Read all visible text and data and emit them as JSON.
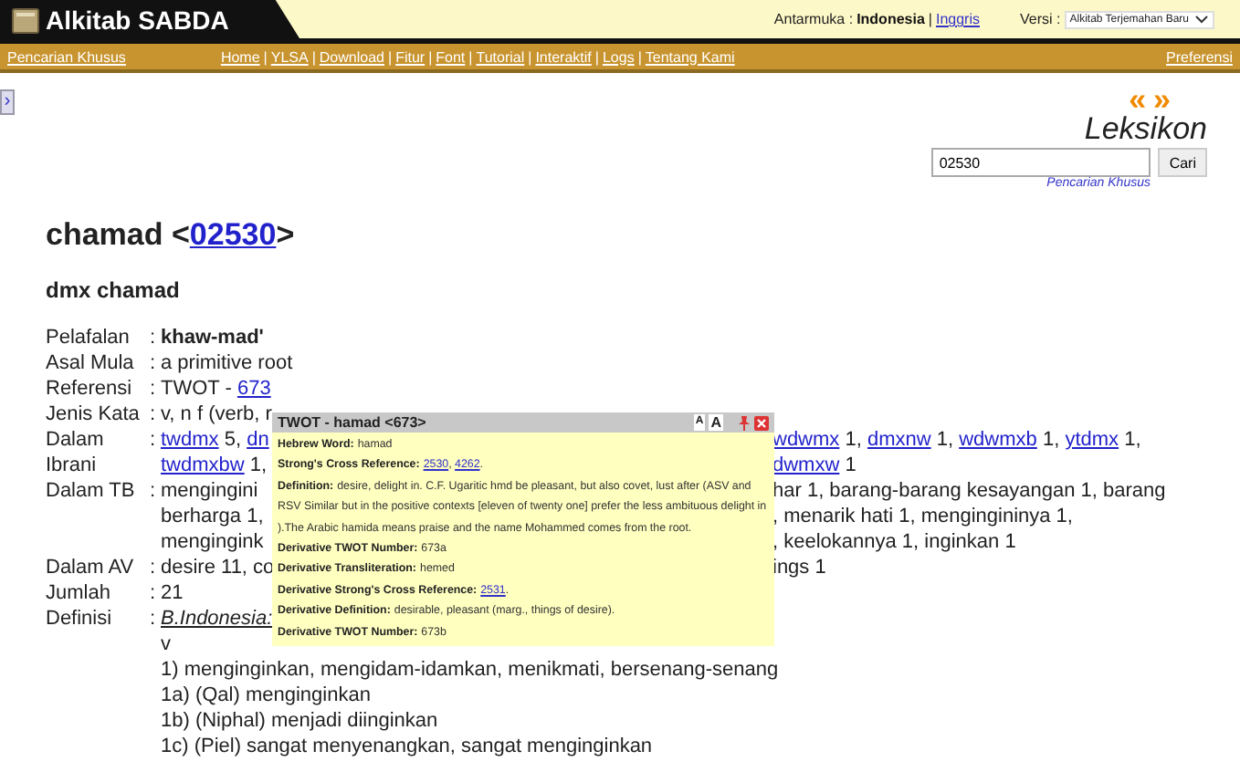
{
  "header": {
    "logo": "Alkitab SABDA",
    "interface_label": "Antarmuka :",
    "languages": [
      {
        "label": "Indonesia",
        "selected": true
      },
      {
        "label": "Inggris",
        "selected": false
      }
    ],
    "language_separator": "|",
    "version_label": "Versi :",
    "version_value": "Alkitab Terjemahan Baru"
  },
  "nav": {
    "left": "Pencarian Khusus",
    "items": [
      {
        "kind": "link",
        "text": "Home"
      },
      {
        "kind": "sep",
        "text": "|"
      },
      {
        "kind": "link",
        "text": "YLSA"
      },
      {
        "kind": "sep",
        "text": "|"
      },
      {
        "kind": "link",
        "text": "Download"
      },
      {
        "kind": "sep",
        "text": "|"
      },
      {
        "kind": "link",
        "text": "Fitur"
      },
      {
        "kind": "sep",
        "text": "|"
      },
      {
        "kind": "link",
        "text": "Font"
      },
      {
        "kind": "sep",
        "text": "|"
      },
      {
        "kind": "link",
        "text": "Tutorial"
      },
      {
        "kind": "sep",
        "text": "|"
      },
      {
        "kind": "link",
        "text": "Interaktif"
      },
      {
        "kind": "sep",
        "text": "|"
      },
      {
        "kind": "link",
        "text": "Logs"
      },
      {
        "kind": "sep",
        "text": "|"
      },
      {
        "kind": "link",
        "text": "Tentang Kami"
      }
    ],
    "right": "Preferensi"
  },
  "sidebar_toggle": "›",
  "lexicon": {
    "prev": "«",
    "next": "»",
    "title": "Leksikon",
    "search_value": "02530",
    "search_button": "Cari",
    "advanced_link": "Pencarian Khusus"
  },
  "entry": {
    "word": "chamad",
    "open": "<",
    "number": "02530",
    "close": ">",
    "subtitle": "dmx chamad",
    "fields": [
      {
        "label": "Pelafalan",
        "colon": ":",
        "lines": [
          {
            "left": [
              {
                "kind": "bold",
                "text": "khaw-mad'"
              }
            ]
          }
        ]
      },
      {
        "label": "Asal Mula",
        "colon": ":",
        "lines": [
          {
            "left": [
              {
                "kind": "text",
                "text": "a primitive root"
              }
            ]
          }
        ]
      },
      {
        "label": "Referensi",
        "colon": ":",
        "lines": [
          {
            "left": [
              {
                "kind": "text",
                "text": "TWOT - "
              },
              {
                "kind": "link",
                "text": "673"
              }
            ]
          }
        ]
      },
      {
        "label": "Jenis Kata",
        "colon": ":",
        "lines": [
          {
            "left": [
              {
                "kind": "text",
                "text": "v, n f (verb, r"
              }
            ]
          }
        ]
      },
      {
        "label": "Dalam Ibrani",
        "colon": ":",
        "lines": [
          {
            "left": [
              {
                "kind": "link",
                "text": "twdmx"
              },
              {
                "kind": "text",
                "text": " 5, "
              },
              {
                "kind": "link",
                "text": "dn"
              }
            ],
            "right": [
              {
                "kind": "link",
                "text": "wdwmx"
              },
              {
                "kind": "text",
                "text": " 1, "
              },
              {
                "kind": "link",
                "text": "dmxnw"
              },
              {
                "kind": "text",
                "text": " 1, "
              },
              {
                "kind": "link",
                "text": "wdwmxb"
              },
              {
                "kind": "text",
                "text": " 1, "
              },
              {
                "kind": "link",
                "text": "ytdmx"
              },
              {
                "kind": "text",
                "text": " 1,"
              }
            ]
          },
          {
            "left": [
              {
                "kind": "link",
                "text": "twdmxbw"
              },
              {
                "kind": "text",
                "text": " 1,"
              }
            ],
            "right": [
              {
                "kind": "link",
                "text": "dwmxw"
              },
              {
                "kind": "text",
                "text": " 1"
              }
            ]
          }
        ]
      },
      {
        "label": "Dalam TB",
        "colon": ":",
        "lines": [
          {
            "left": [
              {
                "kind": "text",
                "text": "mengingini"
              }
            ],
            "right": [
              {
                "kind": "text",
                "text": "har 1, barang-barang kesayangan 1, barang"
              }
            ]
          },
          {
            "left": [
              {
                "kind": "text",
                "text": "berharga 1,"
              }
            ],
            "right": [
              {
                "kind": "text",
                "text": ", menarik hati 1, mengingininya 1,"
              }
            ]
          },
          {
            "left": [
              {
                "kind": "text",
                "text": "mengingink"
              }
            ],
            "right": [
              {
                "kind": "text",
                "text": ", keelokannya 1, inginkan 1"
              }
            ]
          }
        ]
      },
      {
        "label": "Dalam AV",
        "colon": ":",
        "lines": [
          {
            "left": [
              {
                "kind": "text",
                "text": "desire 11, co"
              }
            ],
            "right": [
              {
                "kind": "text",
                "text": "ings 1"
              }
            ]
          }
        ]
      },
      {
        "label": "Jumlah",
        "colon": ":",
        "lines": [
          {
            "left": [
              {
                "kind": "text",
                "text": "21"
              }
            ]
          }
        ]
      },
      {
        "label": "Definisi",
        "colon": ":",
        "lines": [
          {
            "left": [
              {
                "kind": "heading",
                "text": "B.Indonesia:"
              }
            ]
          },
          {
            "left": [
              {
                "kind": "text",
                "text": "v"
              }
            ]
          },
          {
            "left": [
              {
                "kind": "text",
                "text": "1) menginginkan, mengidam-idamkan, menikmati, bersenang-senang"
              }
            ]
          },
          {
            "left": [
              {
                "kind": "text",
                "text": "1a) (Qal) menginginkan"
              }
            ]
          },
          {
            "left": [
              {
                "kind": "text",
                "text": "1b) (Niphal) menjadi diinginkan"
              }
            ]
          },
          {
            "left": [
              {
                "kind": "text",
                "text": "1c) (Piel) sangat menyenangkan, sangat menginginkan"
              }
            ]
          }
        ]
      }
    ]
  },
  "popup": {
    "title": "TWOT - hamad <673>",
    "font_small": "A",
    "font_large": "A",
    "entries": [
      {
        "label": "Hebrew Word:",
        "parts": [
          {
            "kind": "text",
            "text": "hamad"
          }
        ]
      },
      {
        "label": "Strong's Cross Reference:",
        "parts": [
          {
            "kind": "link",
            "text": "2530"
          },
          {
            "kind": "text",
            "text": ", "
          },
          {
            "kind": "link",
            "text": "4262"
          },
          {
            "kind": "text",
            "text": "."
          }
        ]
      },
      {
        "label": "Definition:",
        "parts": [
          {
            "kind": "text",
            "text": "desire, delight in. C.F. Ugaritic hmd be pleasant, but also covet, lust after (ASV and RSV Similar but in the positive contexts [eleven of twenty one] prefer the less ambituous delight in ).The Arabic hamida means praise and the name Mohammed comes from the root."
          }
        ]
      },
      {
        "label": "Derivative TWOT Number:",
        "parts": [
          {
            "kind": "text",
            "text": "673a"
          }
        ]
      },
      {
        "label": "Derivative Transliteration:",
        "parts": [
          {
            "kind": "text",
            "text": "hemed"
          }
        ]
      },
      {
        "label": "Derivative Strong's Cross Reference:",
        "parts": [
          {
            "kind": "link",
            "text": "2531"
          },
          {
            "kind": "text",
            "text": "."
          }
        ]
      },
      {
        "label": "Derivative Definition:",
        "parts": [
          {
            "kind": "text",
            "text": "desirable, pleasant (marg., things of desire)."
          }
        ]
      },
      {
        "label": "Derivative TWOT Number:",
        "parts": [
          {
            "kind": "text",
            "text": "673b"
          }
        ]
      }
    ]
  }
}
